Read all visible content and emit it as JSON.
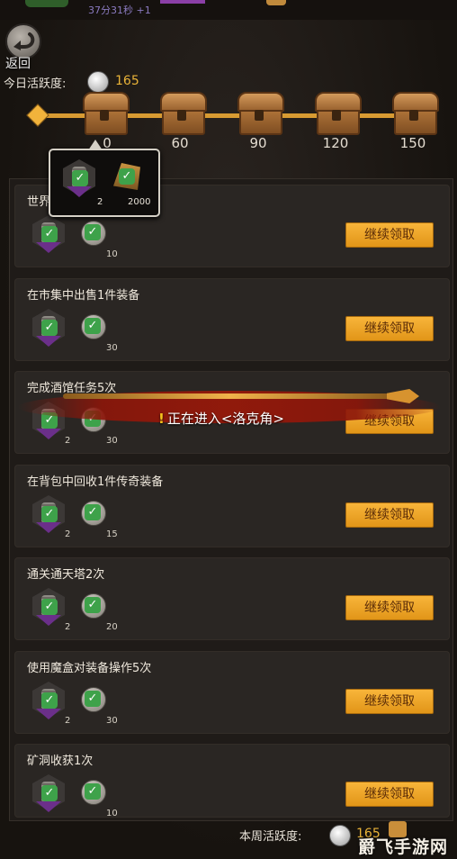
{
  "header": {
    "timer": "37分31秒 +1",
    "back_label": "返回"
  },
  "activity": {
    "label": "今日活跃度:",
    "value": "165"
  },
  "milestones": [
    "0",
    "60",
    "90",
    "120",
    "150"
  ],
  "popup": {
    "item1_count": "2",
    "item2_count": "2000"
  },
  "tasks": [
    {
      "title": "世界",
      "count1": "",
      "count2": "10",
      "button": "继续领取"
    },
    {
      "title": "在市集中出售1件装备",
      "count1": "",
      "count2": "30",
      "button": "继续领取"
    },
    {
      "title": "完成酒馆任务5次",
      "count1": "2",
      "count2": "30",
      "button": "继续领取"
    },
    {
      "title": "在背包中回收1件传奇装备",
      "count1": "2",
      "count2": "15",
      "button": "继续领取"
    },
    {
      "title": "通关通天塔2次",
      "count1": "2",
      "count2": "20",
      "button": "继续领取"
    },
    {
      "title": "使用魔盒对装备操作5次",
      "count1": "2",
      "count2": "30",
      "button": "继续领取"
    },
    {
      "title": "矿洞收获1次",
      "count1": "",
      "count2": "10",
      "button": "继续领取"
    }
  ],
  "toast": {
    "text": "正在进入<洛克角>"
  },
  "weekly": {
    "label": "本周活跃度:",
    "value": "165"
  },
  "watermark": "爵飞手游网",
  "colors": {
    "accent": "#e9b338",
    "button": "#f1a92b",
    "check": "#3ea24a"
  }
}
